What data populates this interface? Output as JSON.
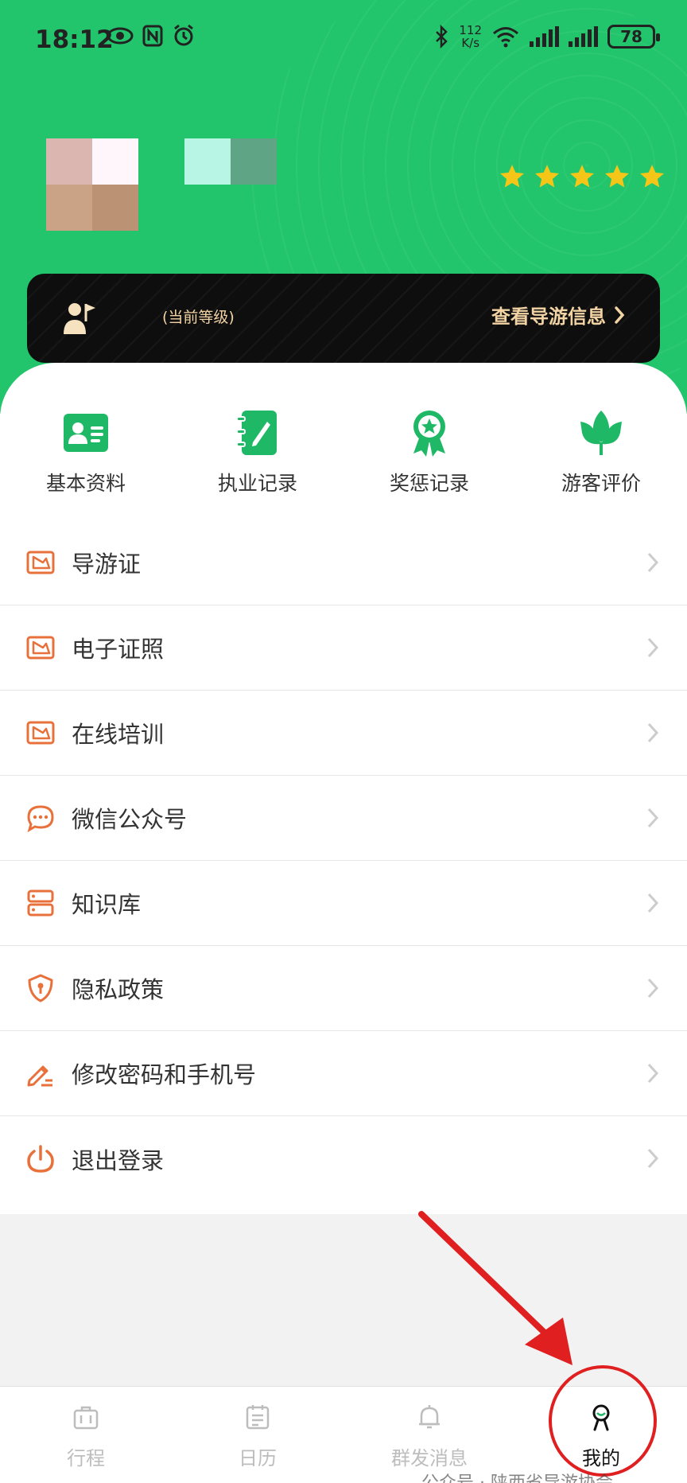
{
  "status_bar": {
    "time": "18:12",
    "net_speed_value": "112",
    "net_speed_unit": "K/s",
    "battery": "78"
  },
  "profile": {
    "level_text": "(当前等级)",
    "view_info_label": "查看导游信息",
    "rating_stars": 5
  },
  "quick_links": [
    {
      "label": "基本资料",
      "icon": "id-card-icon"
    },
    {
      "label": "执业记录",
      "icon": "notebook-pen-icon"
    },
    {
      "label": "奖惩记录",
      "icon": "award-ribbon-icon"
    },
    {
      "label": "游客评价",
      "icon": "lotus-icon"
    }
  ],
  "menu": [
    {
      "label": "导游证",
      "icon": "guide-license-icon"
    },
    {
      "label": "电子证照",
      "icon": "e-license-icon"
    },
    {
      "label": "在线培训",
      "icon": "online-training-icon"
    },
    {
      "label": "微信公众号",
      "icon": "chat-bubble-icon"
    },
    {
      "label": "知识库",
      "icon": "database-icon"
    },
    {
      "label": "隐私政策",
      "icon": "shield-lock-icon"
    },
    {
      "label": "修改密码和手机号",
      "icon": "edit-pen-icon"
    },
    {
      "label": "退出登录",
      "icon": "power-icon"
    }
  ],
  "tabbar": [
    {
      "label": "行程",
      "icon": "briefcase-icon",
      "active": false
    },
    {
      "label": "日历",
      "icon": "calendar-icon",
      "active": false
    },
    {
      "label": "群发消息",
      "icon": "bell-icon",
      "active": false
    },
    {
      "label": "我的",
      "icon": "profile-smile-icon",
      "active": true
    }
  ],
  "watermark": "公众号 · 陕西省导游协会",
  "colors": {
    "header_green": "#22c56b",
    "accent_green": "#1fb866",
    "menu_icon_orange": "#e8703a",
    "level_gold": "#f2d3a3",
    "star_yellow": "#f5c518",
    "annotation_red": "#e02020"
  }
}
